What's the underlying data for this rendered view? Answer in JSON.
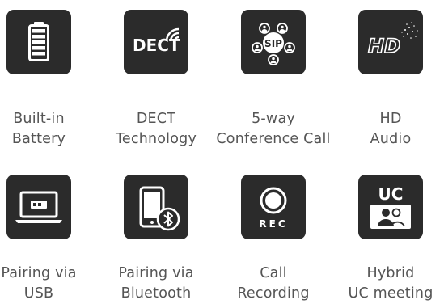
{
  "features": [
    {
      "icon": "battery-icon",
      "line1": "Built-in",
      "line2": "Battery"
    },
    {
      "icon": "dect-icon",
      "icon_text": "DECT",
      "line1": "DECT",
      "line2": "Technology"
    },
    {
      "icon": "conference-call-icon",
      "icon_text": "SIP",
      "line1": "5-way",
      "line2": "Conference Call"
    },
    {
      "icon": "hd-audio-icon",
      "icon_text": "HD",
      "line1": "HD",
      "line2": "Audio"
    },
    {
      "icon": "usb-pairing-icon",
      "line1": "Pairing via",
      "line2": "USB"
    },
    {
      "icon": "bluetooth-pairing-icon",
      "line1": "Pairing via",
      "line2": "Bluetooth"
    },
    {
      "icon": "call-recording-icon",
      "icon_text": "REC",
      "line1": "Call",
      "line2": "Recording"
    },
    {
      "icon": "uc-meeting-icon",
      "icon_text": "UC",
      "line1": "Hybrid",
      "line2": "UC meeting"
    }
  ],
  "colors": {
    "tile": "#2b2b2b",
    "icon": "#ffffff",
    "text": "#555555"
  }
}
